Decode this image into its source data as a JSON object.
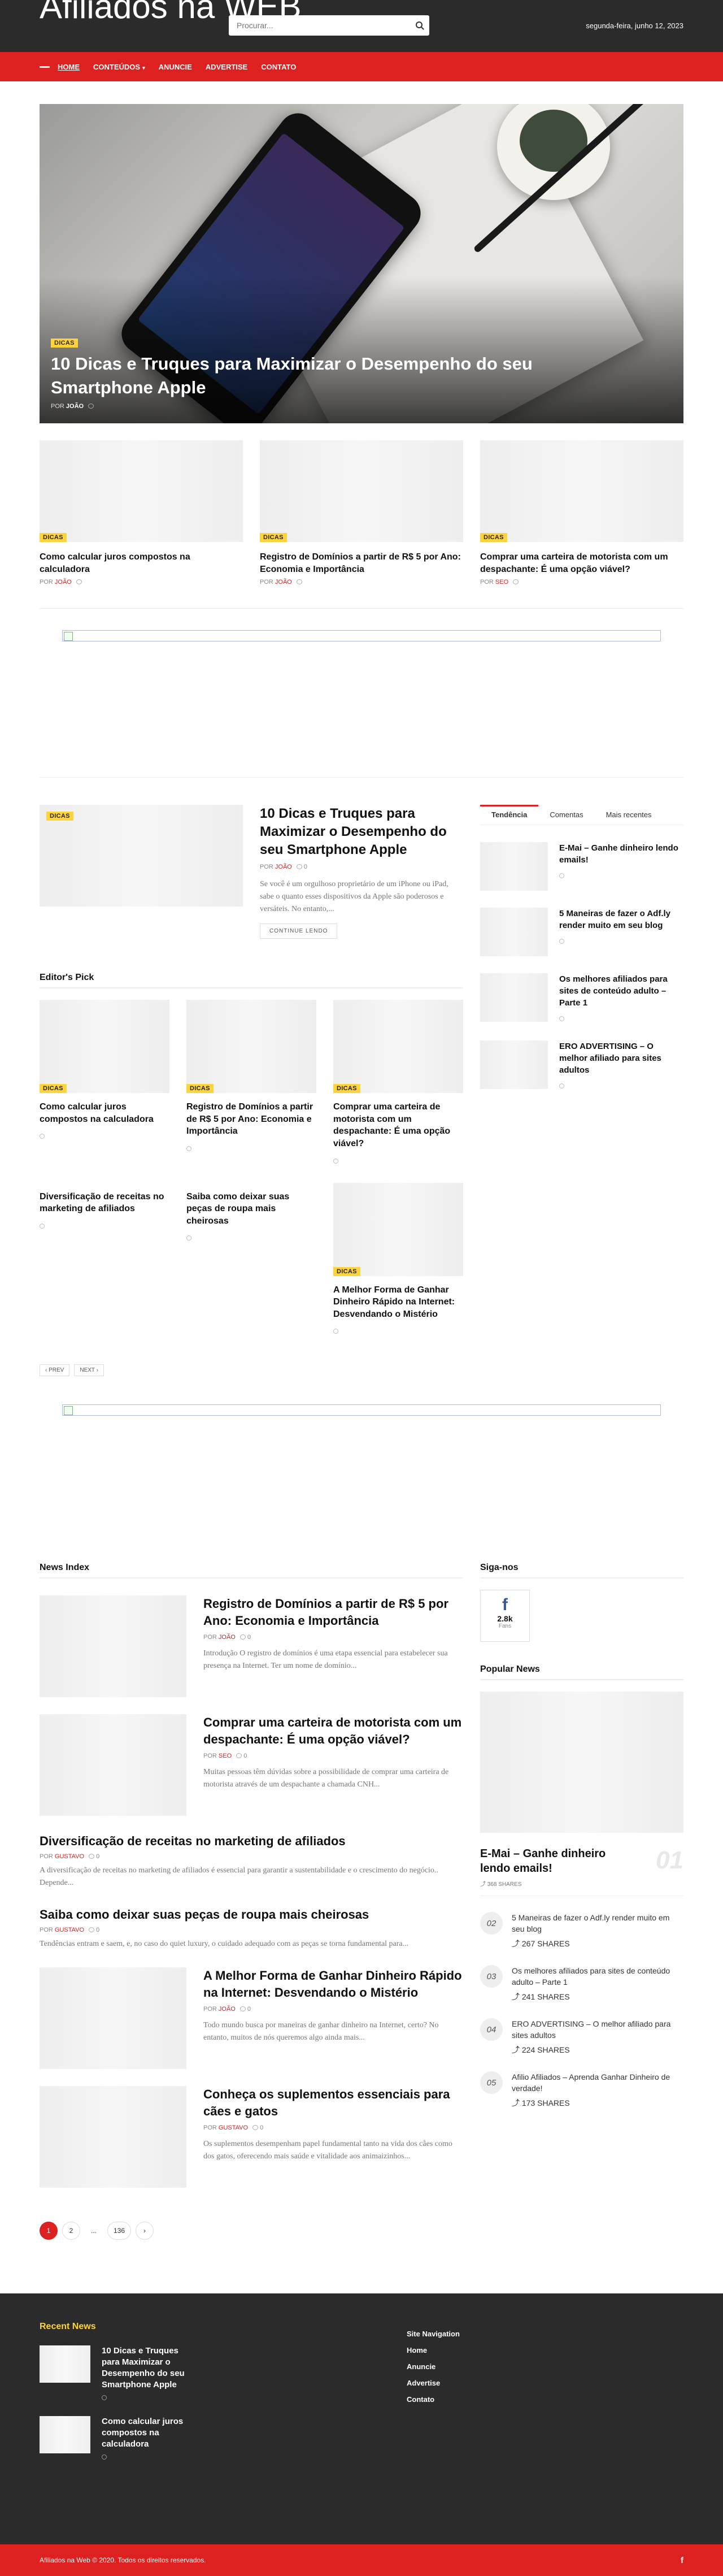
{
  "header": {
    "logo": "Afiliados na WEB",
    "search_placeholder": "Procurar...",
    "date": "segunda-feira, junho 12, 2023"
  },
  "nav": {
    "items": [
      {
        "label": "HOME"
      },
      {
        "label": "CONTEÚDOS"
      },
      {
        "label": "ANUNCIE"
      },
      {
        "label": "ADVERTISE"
      },
      {
        "label": "CONTATO"
      }
    ]
  },
  "hero": {
    "badge": "DICAS",
    "title": "10 Dicas e Truques para Maximizar o Desempenho do seu Smartphone Apple",
    "author_prefix": "POR",
    "author": "JOÃO"
  },
  "cards": [
    {
      "badge": "DICAS",
      "title": "Como calcular juros compostos na calculadora",
      "author_prefix": "POR",
      "author": "JOÃO"
    },
    {
      "badge": "DICAS",
      "title": "Registro de Domínios a partir de R$ 5 por Ano: Economia e Importância",
      "author_prefix": "POR",
      "author": "JOÃO"
    },
    {
      "badge": "DICAS",
      "title": "Comprar uma carteira de motorista com um despachante: É uma opção viável?",
      "author_prefix": "POR",
      "author": "SEO"
    }
  ],
  "featured": {
    "badge": "DICAS",
    "title": "10 Dicas e Truques para Maximizar o Desempenho do seu Smartphone Apple",
    "author_prefix": "POR",
    "author": "JOÃO",
    "comments": "0",
    "excerpt": "Se você é um orgulhoso proprietário de um iPhone ou iPad, sabe o quanto esses dispositivos da Apple são poderosos e versáteis. No entanto,...",
    "button": "CONTINUE LENDO"
  },
  "editors": {
    "heading": "Editor's Pick",
    "items": [
      {
        "badge": "DICAS",
        "title": "Como calcular juros compostos na calculadora",
        "img": true
      },
      {
        "badge": "DICAS",
        "title": "Registro de Domínios a partir de R$ 5 por Ano: Economia e Importância",
        "img": true
      },
      {
        "badge": "DICAS",
        "title": "Comprar uma carteira de motorista com um despachante: É uma opção viável?",
        "img": true
      },
      {
        "badge": "",
        "title": "Diversificação de receitas no marketing de afiliados",
        "img": false
      },
      {
        "badge": "",
        "title": "Saiba como deixar suas peças de roupa mais cheirosas",
        "img": false
      },
      {
        "badge": "DICAS",
        "title": "A Melhor Forma de Ganhar Dinheiro Rápido na Internet: Desvendando o Mistério",
        "img": true
      }
    ],
    "prev": "‹ PREV",
    "next": "NEXT ›"
  },
  "sidebar_tabs": {
    "tabs": [
      "Tendência",
      "Comentas",
      "Mais recentes"
    ],
    "items": [
      {
        "title": "E-Mai – Ganhe dinheiro lendo emails!"
      },
      {
        "title": "5 Maneiras de fazer o Adf.ly render muito em seu blog"
      },
      {
        "title": "Os melhores afiliados para sites de conteúdo adulto – Parte 1"
      },
      {
        "title": "ERO ADVERTISING – O melhor afiliado para sites adultos"
      }
    ]
  },
  "news": {
    "heading": "News Index",
    "items": [
      {
        "img": true,
        "title": "Registro de Domínios a partir de R$ 5 por Ano: Economia e Importância",
        "author_prefix": "POR",
        "author": "JOÃO",
        "comments": "0",
        "excerpt": "Introdução O registro de domínios é uma etapa essencial para estabelecer sua presença na Internet. Ter um nome de domínio..."
      },
      {
        "img": true,
        "title": "Comprar uma carteira de motorista com um despachante: É uma opção viável?",
        "author_prefix": "POR",
        "author": "SEO",
        "comments": "0",
        "excerpt": "Muitas pessoas têm dúvidas sobre a possibilidade de comprar uma carteira de motorista através de um despachante a chamada CNH..."
      },
      {
        "img": false,
        "title": "Diversificação de receitas no marketing de afiliados",
        "author_prefix": "POR",
        "author": "GUSTAVO",
        "comments": "0",
        "excerpt": "A diversificação de receitas no marketing de afiliados é essencial para garantir a sustentabilidade e o crescimento do negócio.. Depende..."
      },
      {
        "img": false,
        "title": "Saiba como deixar suas peças de roupa mais cheirosas",
        "author_prefix": "POR",
        "author": "GUSTAVO",
        "comments": "0",
        "excerpt": "Tendências entram e saem, e, no caso do quiet luxury, o cuidado adequado com as peças se torna fundamental para..."
      },
      {
        "img": true,
        "title": "A Melhor Forma de Ganhar Dinheiro Rápido na Internet: Desvendando o Mistério",
        "author_prefix": "POR",
        "author": "JOÃO",
        "comments": "0",
        "excerpt": "Todo mundo busca por maneiras de ganhar dinheiro na Internet, certo? No entanto, muitos de nós queremos algo ainda mais..."
      },
      {
        "img": true,
        "title": "Conheça os suplementos essenciais para cães e gatos",
        "author_prefix": "POR",
        "author": "GUSTAVO",
        "comments": "0",
        "excerpt": "Os suplementos desempenham papel fundamental tanto na vida dos cães como dos gatos, oferecendo mais saúde e vitalidade aos animaizinhos..."
      }
    ],
    "pages": [
      "1",
      "2",
      "...",
      "136",
      "›"
    ]
  },
  "follow": {
    "heading": "Siga-nos",
    "fb_count": "2.8k",
    "fb_label": "Fans"
  },
  "popular": {
    "heading": "Popular News",
    "big": {
      "title": "E-Mai – Ganhe dinheiro lendo emails!",
      "num": "01",
      "shares": "368 SHARES"
    },
    "items": [
      {
        "num": "02",
        "title": "5 Maneiras de fazer o Adf.ly render muito em seu blog",
        "shares": "267 SHARES"
      },
      {
        "num": "03",
        "title": "Os melhores afiliados para sites de conteúdo adulto – Parte 1",
        "shares": "241 SHARES"
      },
      {
        "num": "04",
        "title": "ERO ADVERTISING – O melhor afiliado para sites adultos",
        "shares": "224 SHARES"
      },
      {
        "num": "05",
        "title": "Afilio Afiliados – Aprenda Ganhar Dinheiro de verdade!",
        "shares": "173 SHARES"
      }
    ]
  },
  "footer": {
    "recent_heading": "Recent News",
    "recent": [
      {
        "title": "10 Dicas e Truques para Maximizar o Desempenho do seu Smartphone Apple"
      },
      {
        "title": "Como calcular juros compostos na calculadora"
      }
    ],
    "nav_heading": "Site Navigation",
    "nav": [
      "Home",
      "Anuncie",
      "Advertise",
      "Contato"
    ],
    "copyright": "Afiliados na Web © 2020. Todos os direitos reservados.",
    "fb_icon": "f"
  },
  "colors": {
    "accent": "#dd2020",
    "badge": "#ffd33c",
    "dark": "#2b2b2b"
  }
}
